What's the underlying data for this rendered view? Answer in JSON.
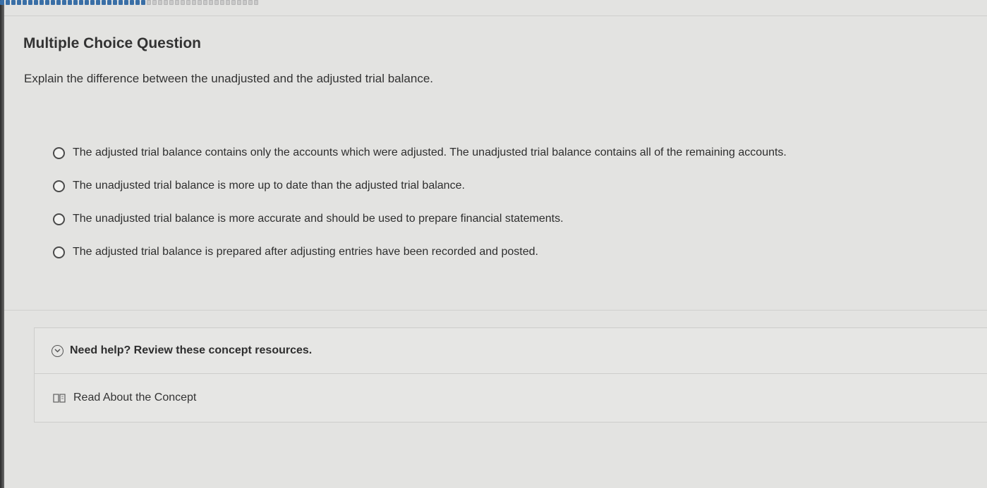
{
  "progress": {
    "total_segments": 46,
    "completed_segments": 26
  },
  "question": {
    "type_label": "Multiple Choice Question",
    "prompt": "Explain the difference between the unadjusted and the adjusted trial balance."
  },
  "options": [
    {
      "label": "The adjusted trial balance contains only the accounts which were adjusted. The unadjusted trial balance contains all of the remaining accounts.",
      "selected": false
    },
    {
      "label": "The unadjusted trial balance is more up to date than the adjusted trial balance.",
      "selected": false
    },
    {
      "label": "The unadjusted trial balance is more accurate and should be used to prepare financial statements.",
      "selected": false
    },
    {
      "label": "The adjusted trial balance is prepared after adjusting entries have been recorded and posted.",
      "selected": false
    }
  ],
  "resources": {
    "help_label": "Need help? Review these concept resources.",
    "help_icon": "chevron-down-circle-icon",
    "concept_label": "Read About the Concept",
    "concept_icon": "book-icon"
  },
  "colors": {
    "progress_done": "#3a6fa6",
    "background": "#e3e3e1"
  }
}
